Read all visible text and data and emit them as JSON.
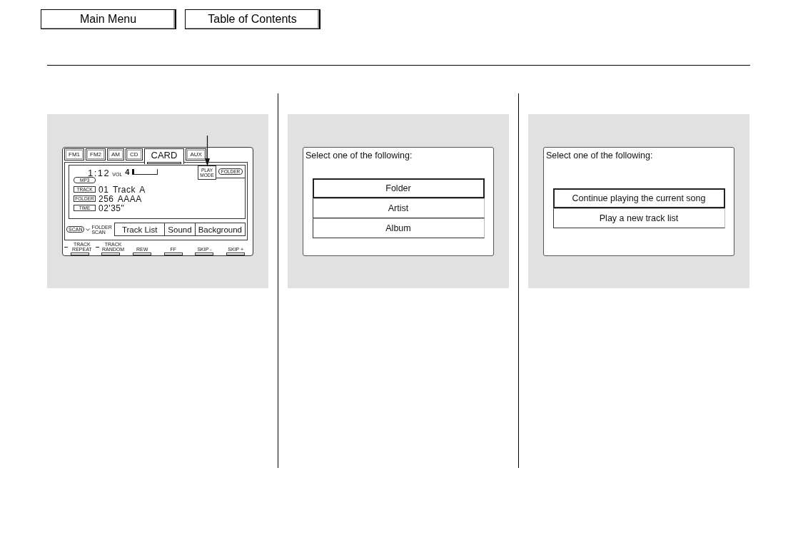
{
  "nav_buttons": [
    {
      "label": "Main Menu"
    },
    {
      "label": "Table of Contents"
    }
  ],
  "panels": [
    {
      "kind": "audio_display",
      "display": {
        "tabs": [
          {
            "label": "FM1",
            "selected": false
          },
          {
            "label": "FM2",
            "selected": false
          },
          {
            "label": "AM",
            "selected": false
          },
          {
            "label": "CD",
            "selected": false
          },
          {
            "label": "CARD",
            "selected": true
          },
          {
            "label": "AUX",
            "selected": false
          }
        ],
        "time": "1:12",
        "volume": {
          "label": "VOL",
          "value": "4",
          "level": 0.08
        },
        "play_mode": "PLAY MODE",
        "folder_badge": "FOLDER",
        "format_badge": "MP3",
        "info_rows": [
          {
            "label": "TRACK",
            "value": "01 Track A"
          },
          {
            "label": "FOLDER",
            "value": "256 AAAA"
          },
          {
            "label": "TIME",
            "value": "02'35\""
          }
        ],
        "scan": {
          "label": "SCAN",
          "hold_label": "FOLDER SCAN"
        },
        "soft_keys": [
          "Track List",
          "Sound",
          "Background"
        ],
        "hardware_keys": [
          {
            "label": "TRACK REPEAT",
            "long_press": true
          },
          {
            "label": "TRACK RANDOM",
            "long_press": true
          },
          {
            "label": "REW",
            "long_press": false
          },
          {
            "label": "FF",
            "long_press": false
          },
          {
            "label": "SKIP -",
            "long_press": false
          },
          {
            "label": "SKIP +",
            "long_press": false
          }
        ]
      }
    },
    {
      "kind": "menu",
      "prompt": "Select one of the following:",
      "options": [
        {
          "label": "Folder",
          "selected": true
        },
        {
          "label": "Artist",
          "selected": false
        },
        {
          "label": "Album",
          "selected": false
        }
      ]
    },
    {
      "kind": "menu",
      "prompt": "Select one of the following:",
      "options": [
        {
          "label": "Continue playing the current song",
          "selected": true
        },
        {
          "label": "Play a new track list",
          "selected": false
        }
      ]
    }
  ]
}
